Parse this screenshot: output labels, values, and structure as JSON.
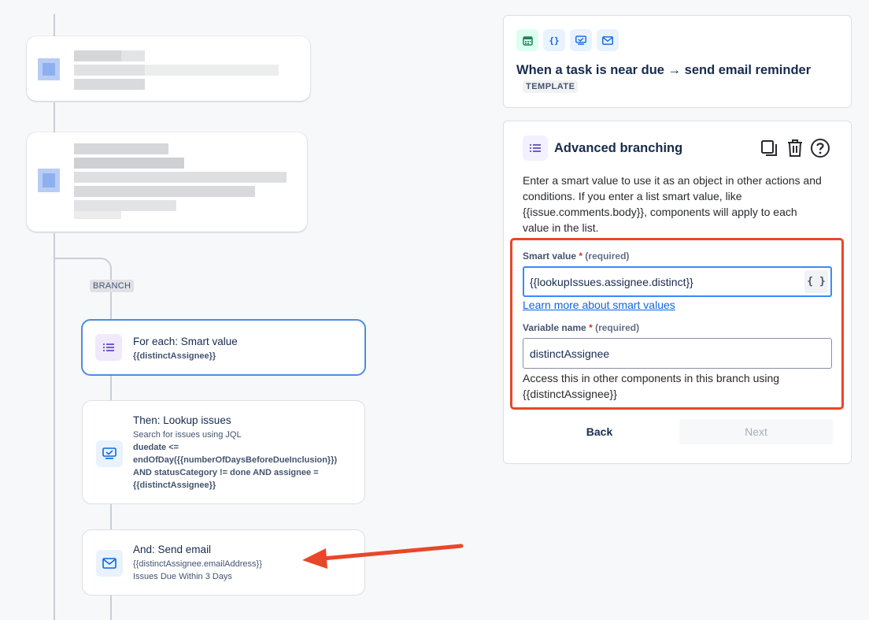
{
  "canvas": {
    "branch_label": "BRANCH",
    "nodes": [
      {
        "title": "For each: Smart value",
        "lines": [
          "{{distinctAssignee}}"
        ]
      },
      {
        "title": "Then: Lookup issues",
        "lines": [
          "Search for issues using JQL",
          "duedate <=",
          "endOfDay({{numberOfDaysBeforeDueInclusion}})",
          "AND statusCategory != done AND assignee =",
          "{{distinctAssignee}}"
        ]
      },
      {
        "title": "And: Send email",
        "lines": [
          "{{distinctAssignee.emailAddress}}",
          "Issues Due Within 3 Days"
        ]
      }
    ]
  },
  "template": {
    "icons": [
      "calendar-icon",
      "braces-icon",
      "monitor-icon",
      "mail-icon"
    ],
    "title": "When a task is near due → send email reminder",
    "badge": "TEMPLATE"
  },
  "branching": {
    "title": "Advanced branching",
    "description": "Enter a smart value to use it as an object in other actions and conditions. If you enter a list smart value, like {{issue.comments.body}}, components will apply to each value in the list.",
    "smart_value": {
      "label": "Smart value",
      "star": "*",
      "required": "(required)",
      "value": "{{lookupIssues.assignee.distinct}}",
      "button": "{ }"
    },
    "learn_more": "Learn more about smart values",
    "variable_name": {
      "label": "Variable name",
      "star": "*",
      "required": "(required)",
      "value": "distinctAssignee"
    },
    "help": "Access this in other components in this branch using {{distinctAssignee}}",
    "back": "Back",
    "next": "Next"
  },
  "colors": {
    "accent": "#388bff",
    "annotation": "#e8472a",
    "link": "#0c66e4"
  }
}
